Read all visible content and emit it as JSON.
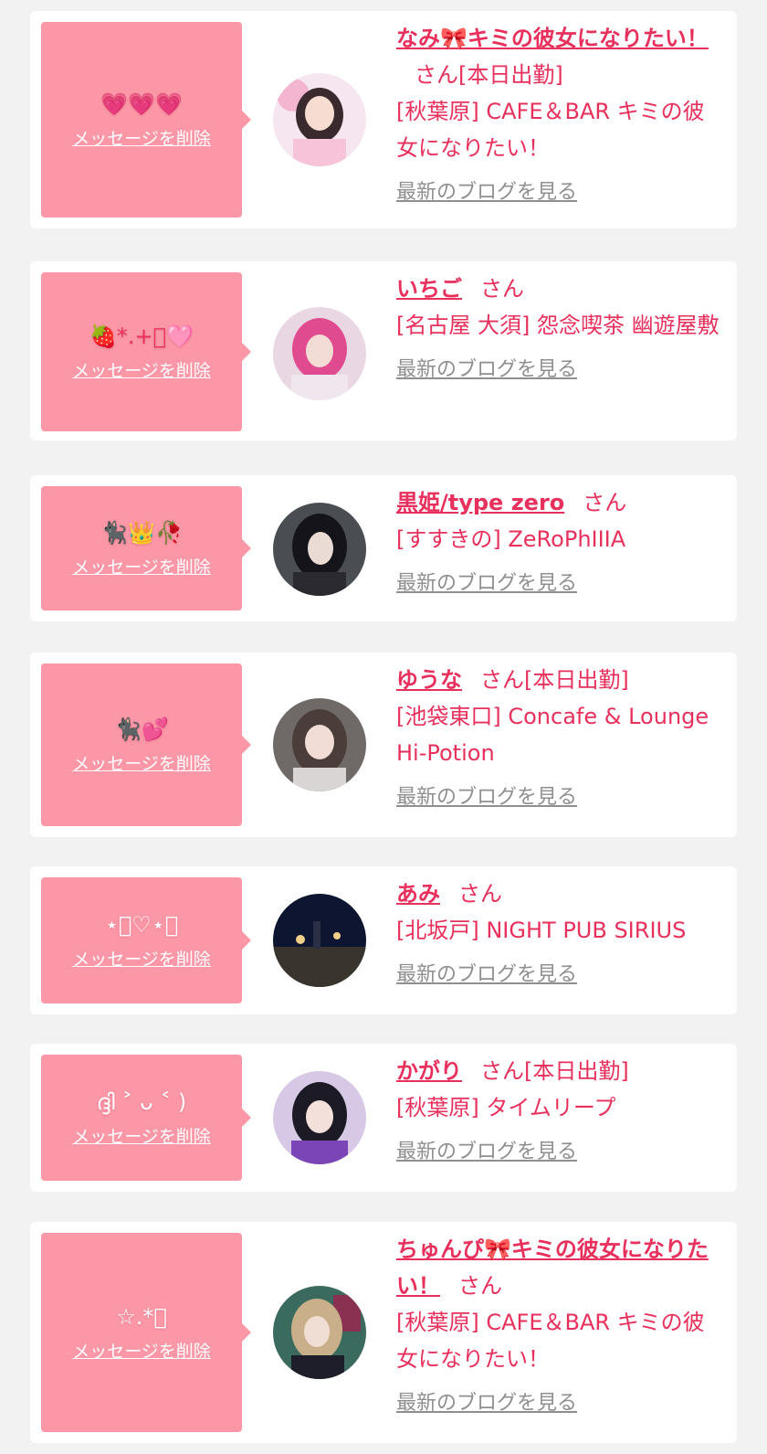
{
  "colors": {
    "accent": "#e8305c",
    "bubble": "#fb97a6",
    "muted": "#8f8f8f",
    "background": "#f2f2f2"
  },
  "entries": [
    {
      "message": "💗💗💗",
      "delete_label": "メッセージを削除",
      "name": "なみ🎀キミの彼女になりたい！",
      "honorific": "さん",
      "status": "[本日出勤]",
      "shop": "[秋葉原] CAFE＆BAR キミの彼女になりたい！",
      "blog_label": "最新のブログを見る"
    },
    {
      "message": "🍓*.+ﾟ🩷",
      "delete_label": "メッセージを削除",
      "name": "いちご",
      "honorific": "さん",
      "status": "",
      "shop": "[名古屋 大須] 怨念喫茶 幽遊屋敷",
      "blog_label": "最新のブログを見る"
    },
    {
      "message": "🐈‍⬛👑🥀",
      "delete_label": "メッセージを削除",
      "name": "黒姫/type zero",
      "honorific": "さん",
      "status": "",
      "shop": "[すすきの] ZeRoPhIIIA",
      "blog_label": "最新のブログを見る"
    },
    {
      "message": "🐈‍⬛💕",
      "delete_label": "メッセージを削除",
      "name": "ゆうな",
      "honorific": "さん",
      "status": "[本日出勤]",
      "shop": "[池袋東口] Concafe & Lounge Hi-Potion",
      "blog_label": "最新のブログを見る"
    },
    {
      "message": "⋆͛♡⋆͛",
      "delete_label": "メッセージを削除",
      "name": "あみ",
      "honorific": "さん",
      "status": "",
      "shop": "[北坂戸] NIGHT PUB SIRIUS",
      "blog_label": "最新のブログを見る"
    },
    {
      "message": "ദ്ദി ˃ ᴗ ˂ )",
      "delete_label": "メッセージを削除",
      "name": "かがり",
      "honorific": "さん",
      "status": "[本日出勤]",
      "shop": "[秋葉原] タイムリープ",
      "blog_label": "最新のブログを見る"
    },
    {
      "message": "☆.*ﾟ",
      "delete_label": "メッセージを削除",
      "name": "ちゅんぴ🎀キミの彼女になりたい！",
      "honorific": "さん",
      "status": "",
      "shop": "[秋葉原] CAFE＆BAR キミの彼女になりたい！",
      "blog_label": "最新のブログを見る"
    }
  ]
}
